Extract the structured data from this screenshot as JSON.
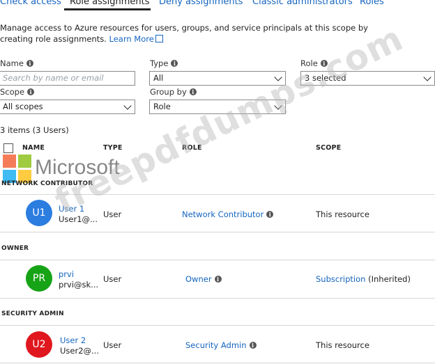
{
  "tabs": [
    {
      "label": "Check access"
    },
    {
      "label": "Role assignments"
    },
    {
      "label": "Deny assignments"
    },
    {
      "label": "Classic administrators"
    },
    {
      "label": "Roles"
    }
  ],
  "description": {
    "text": "Manage access to Azure resources for users, groups, and service principals at this scope by creating role assignments.",
    "link": "Learn More"
  },
  "filters": {
    "name": {
      "label": "Name",
      "placeholder": "Search by name or email"
    },
    "type": {
      "label": "Type",
      "value": "All"
    },
    "role": {
      "label": "Role",
      "value": "3 selected"
    },
    "scope": {
      "label": "Scope",
      "value": "All scopes"
    },
    "group_by": {
      "label": "Group by",
      "value": "Role"
    }
  },
  "items_count": "3 items (3 Users)",
  "columns": {
    "name": "NAME",
    "type": "TYPE",
    "role": "ROLE",
    "scope": "SCOPE"
  },
  "groups": [
    {
      "title": "NETWORK CONTRIBUTOR",
      "rows": [
        {
          "initials": "U1",
          "name": "User 1",
          "email": "User1@...",
          "type": "User",
          "role": "Network Contributor",
          "scope": "This resource",
          "inherited": "",
          "avatar_color": "#2b7de0"
        }
      ]
    },
    {
      "title": "OWNER",
      "rows": [
        {
          "initials": "PR",
          "name": "prvi",
          "email": "prvi@sk...",
          "type": "User",
          "role": "Owner",
          "scope": "Subscription",
          "inherited": "(Inherited)",
          "avatar_color": "#16a316"
        }
      ]
    },
    {
      "title": "SECURITY ADMIN",
      "rows": [
        {
          "initials": "U2",
          "name": "User 2",
          "email": "User2@...",
          "type": "User",
          "role": "Security Admin",
          "scope": "This resource",
          "inherited": "",
          "avatar_color": "#e0171f"
        }
      ]
    }
  ],
  "watermark": {
    "logo_text": "Microsoft",
    "site_text": "freepdfdumps.com"
  },
  "colors": {
    "link": "#1565c0",
    "logo_red": "#f25022",
    "logo_green": "#7fba00",
    "logo_blue": "#00a4ef",
    "logo_yellow": "#ffb900"
  }
}
